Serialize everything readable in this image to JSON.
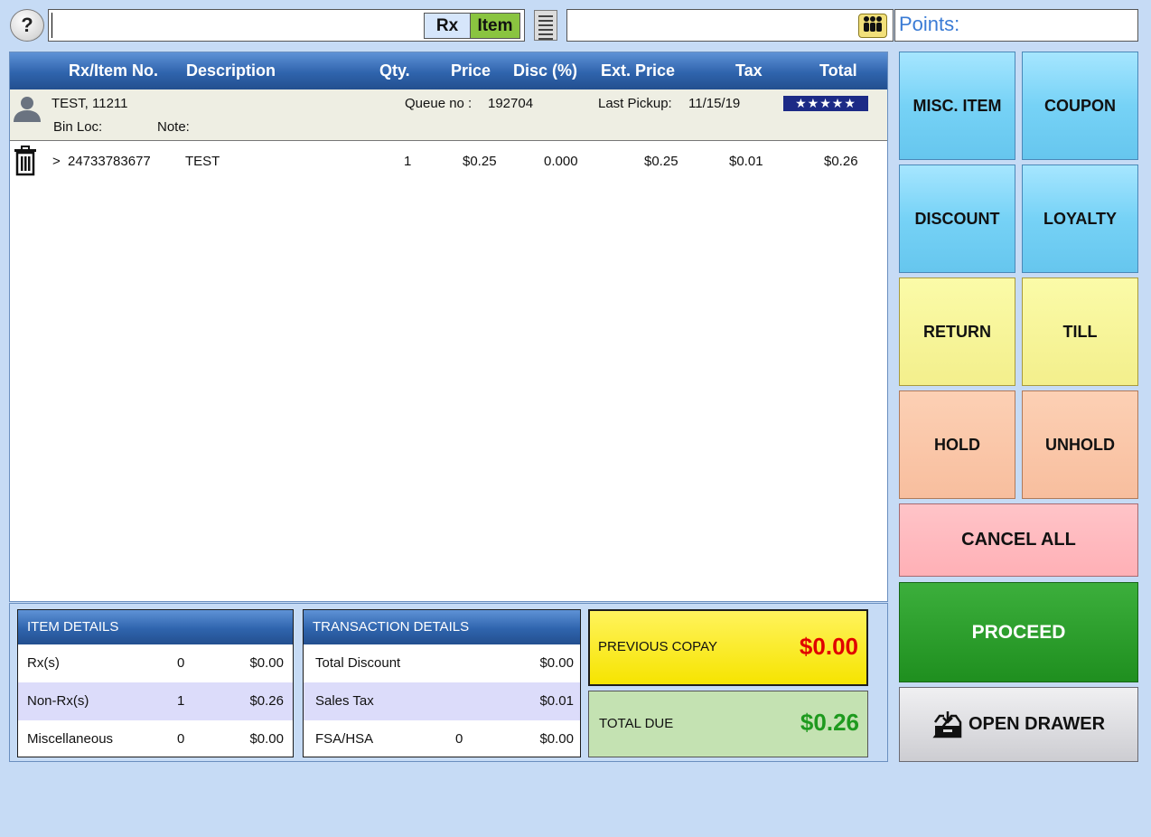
{
  "topbar": {
    "help_glyph": "?",
    "search_value": "",
    "mode_rx": "Rx",
    "mode_item": "Item",
    "customer_search_value": "",
    "points_label": "Points:"
  },
  "grid": {
    "headers": {
      "rx_item_no": "Rx/Item No.",
      "description": "Description",
      "qty": "Qty.",
      "price": "Price",
      "disc": "Disc (%)",
      "ext_price": "Ext. Price",
      "tax": "Tax",
      "total": "Total"
    },
    "customer": {
      "name": "TEST, 11211",
      "queue_label": "Queue no :",
      "queue_no": "192704",
      "last_pickup_label": "Last Pickup:",
      "last_pickup": "11/15/19",
      "bin_loc_label": "Bin Loc:",
      "note_label": "Note:",
      "rating_stars": "★★★★★",
      "rating": 5
    },
    "items": [
      {
        "marker": ">",
        "item_no": "24733783677",
        "description": "TEST",
        "qty": "1",
        "price": "$0.25",
        "disc": "0.000",
        "ext_price": "$0.25",
        "tax": "$0.01",
        "total": "$0.26"
      }
    ]
  },
  "item_details": {
    "title": "ITEM DETAILS",
    "rows": [
      {
        "label": "Rx(s)",
        "count": "0",
        "amount": "$0.00"
      },
      {
        "label": "Non-Rx(s)",
        "count": "1",
        "amount": "$0.26"
      },
      {
        "label": "Miscellaneous",
        "count": "0",
        "amount": "$0.00"
      }
    ]
  },
  "transaction_details": {
    "title": "TRANSACTION DETAILS",
    "total_discount_label": "Total Discount",
    "total_discount": "$0.00",
    "sales_tax_label": "Sales Tax",
    "sales_tax": "$0.01",
    "fsa_label": "FSA/HSA",
    "fsa_count": "0",
    "fsa_amount": "$0.00"
  },
  "totals": {
    "previous_copay_label": "PREVIOUS COPAY",
    "previous_copay": "$0.00",
    "total_due_label": "TOTAL DUE",
    "total_due": "$0.26"
  },
  "actions": {
    "misc_item": "MISC. ITEM",
    "coupon": "COUPON",
    "discount": "DISCOUNT",
    "loyalty": "LOYALTY",
    "return": "RETURN",
    "till": "TILL",
    "hold": "HOLD",
    "unhold": "UNHOLD",
    "cancel_all": "CANCEL ALL",
    "proceed": "PROCEED",
    "open_drawer": "OPEN DRAWER"
  },
  "colors": {
    "copay_amount": "#e00000",
    "due_amount": "#1e9a1e",
    "header_blue": "#2f64ad"
  }
}
